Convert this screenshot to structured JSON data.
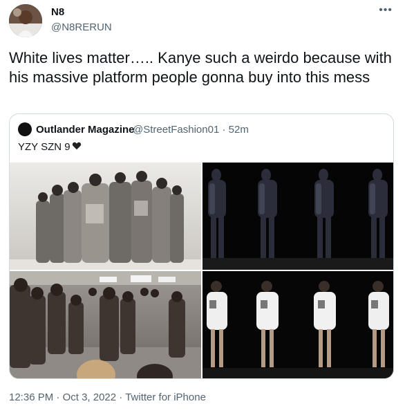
{
  "author": {
    "display_name": "N8",
    "handle": "@N8RERUN",
    "avatar_icon": "profile-photo-icon"
  },
  "more_icon": "ellipsis-icon",
  "tweet": {
    "text": "White lives matter….. Kanye such a weirdo because with his massive platform people gonna buy into this mess"
  },
  "quote": {
    "display_name": "Outlander Magazine",
    "handle": "@StreetFashion01",
    "separator": "·",
    "time_ago": "52m",
    "text": "YZY SZN 9",
    "emoji_icon": "black-heart-icon"
  },
  "footer": {
    "time": "12:36 PM",
    "separator": "·",
    "date": "Oct 3, 2022",
    "source": "Twitter for iPhone"
  },
  "colors": {
    "text_primary": "#0f1419",
    "text_secondary": "#536471",
    "border": "#cfd9de"
  }
}
